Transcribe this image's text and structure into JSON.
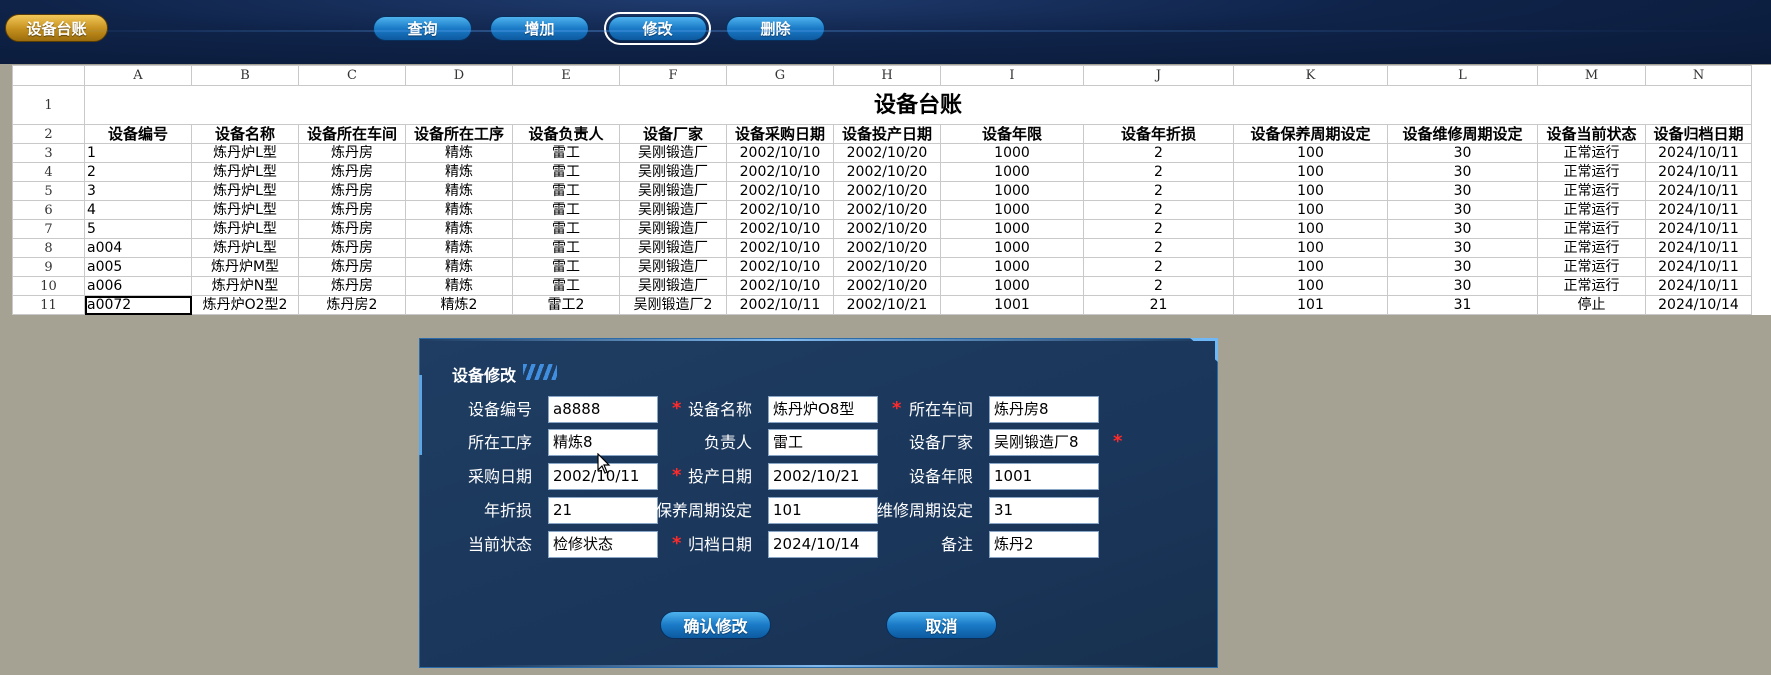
{
  "toolbar": {
    "title": "设备台账",
    "buttons": [
      {
        "label": "查询"
      },
      {
        "label": "增加"
      },
      {
        "label": "修改"
      },
      {
        "label": "删除"
      }
    ]
  },
  "sheet": {
    "columns": [
      "A",
      "B",
      "C",
      "D",
      "E",
      "F",
      "G",
      "H",
      "I",
      "J",
      "K",
      "L",
      "M",
      "N"
    ],
    "title": "设备台账",
    "headers": [
      "设备编号",
      "设备名称",
      "设备所在车间",
      "设备所在工序",
      "设备负责人",
      "设备厂家",
      "设备采购日期",
      "设备投产日期",
      "设备年限",
      "设备年折损",
      "设备保养周期设定",
      "设备维修周期设定",
      "设备当前状态",
      "设备归档日期"
    ],
    "rows": [
      {
        "num": "3",
        "cells": [
          "1",
          "炼丹炉L型",
          "炼丹房",
          "精炼",
          "雷工",
          "吴刚锻造厂",
          "2002/10/10",
          "2002/10/20",
          "1000",
          "2",
          "100",
          "30",
          "正常运行",
          "2024/10/11"
        ]
      },
      {
        "num": "4",
        "cells": [
          "2",
          "炼丹炉L型",
          "炼丹房",
          "精炼",
          "雷工",
          "吴刚锻造厂",
          "2002/10/10",
          "2002/10/20",
          "1000",
          "2",
          "100",
          "30",
          "正常运行",
          "2024/10/11"
        ]
      },
      {
        "num": "5",
        "cells": [
          "3",
          "炼丹炉L型",
          "炼丹房",
          "精炼",
          "雷工",
          "吴刚锻造厂",
          "2002/10/10",
          "2002/10/20",
          "1000",
          "2",
          "100",
          "30",
          "正常运行",
          "2024/10/11"
        ]
      },
      {
        "num": "6",
        "cells": [
          "4",
          "炼丹炉L型",
          "炼丹房",
          "精炼",
          "雷工",
          "吴刚锻造厂",
          "2002/10/10",
          "2002/10/20",
          "1000",
          "2",
          "100",
          "30",
          "正常运行",
          "2024/10/11"
        ]
      },
      {
        "num": "7",
        "cells": [
          "5",
          "炼丹炉L型",
          "炼丹房",
          "精炼",
          "雷工",
          "吴刚锻造厂",
          "2002/10/10",
          "2002/10/20",
          "1000",
          "2",
          "100",
          "30",
          "正常运行",
          "2024/10/11"
        ]
      },
      {
        "num": "8",
        "cells": [
          "a004",
          "炼丹炉L型",
          "炼丹房",
          "精炼",
          "雷工",
          "吴刚锻造厂",
          "2002/10/10",
          "2002/10/20",
          "1000",
          "2",
          "100",
          "30",
          "正常运行",
          "2024/10/11"
        ]
      },
      {
        "num": "9",
        "cells": [
          "a005",
          "炼丹炉M型",
          "炼丹房",
          "精炼",
          "雷工",
          "吴刚锻造厂",
          "2002/10/10",
          "2002/10/20",
          "1000",
          "2",
          "100",
          "30",
          "正常运行",
          "2024/10/11"
        ]
      },
      {
        "num": "10",
        "cells": [
          "a006",
          "炼丹炉N型",
          "炼丹房",
          "精炼",
          "雷工",
          "吴刚锻造厂",
          "2002/10/10",
          "2002/10/20",
          "1000",
          "2",
          "100",
          "30",
          "正常运行",
          "2024/10/11"
        ]
      },
      {
        "num": "11",
        "cells": [
          "a0072",
          "炼丹炉O2型2",
          "炼丹房2",
          "精炼2",
          "雷工2",
          "吴刚锻造厂2",
          "2002/10/11",
          "2002/10/21",
          "1001",
          "21",
          "101",
          "31",
          "停止",
          "2024/10/14"
        ]
      }
    ]
  },
  "dialog": {
    "title": "设备修改",
    "fields": [
      {
        "label": "设备编号",
        "value": "a8888",
        "required": true
      },
      {
        "label": "设备名称",
        "value": "炼丹炉O8型",
        "required": true
      },
      {
        "label": "所在车间",
        "value": "炼丹房8",
        "required": false
      },
      {
        "label": "所在工序",
        "value": "精炼8",
        "required": false
      },
      {
        "label": "负责人",
        "value": "雷工",
        "required": false
      },
      {
        "label": "设备厂家",
        "value": "吴刚锻造厂8",
        "required": true
      },
      {
        "label": "采购日期",
        "value": "2002/10/11",
        "required": true
      },
      {
        "label": "投产日期",
        "value": "2002/10/21",
        "required": false
      },
      {
        "label": "设备年限",
        "value": "1001",
        "required": false
      },
      {
        "label": "年折损",
        "value": "21",
        "required": false
      },
      {
        "label": "保养周期设定",
        "value": "101",
        "required": false
      },
      {
        "label": "维修周期设定",
        "value": "31",
        "required": false
      },
      {
        "label": "当前状态",
        "value": "检修状态",
        "required": true
      },
      {
        "label": "归档日期",
        "value": "2024/10/14",
        "required": false
      },
      {
        "label": "备注",
        "value": "炼丹2",
        "required": false
      }
    ],
    "required_mark": "*",
    "confirm_label": "确认修改",
    "cancel_label": "取消"
  },
  "colors": {
    "toolbar_bg": "#0f2349",
    "title_pill": "#c48f1c",
    "button_blue": "#1a7ac6",
    "dialog_bg": "#1f3d62",
    "required_star": "#ff2a2a",
    "desktop_bg": "#a5a293"
  }
}
